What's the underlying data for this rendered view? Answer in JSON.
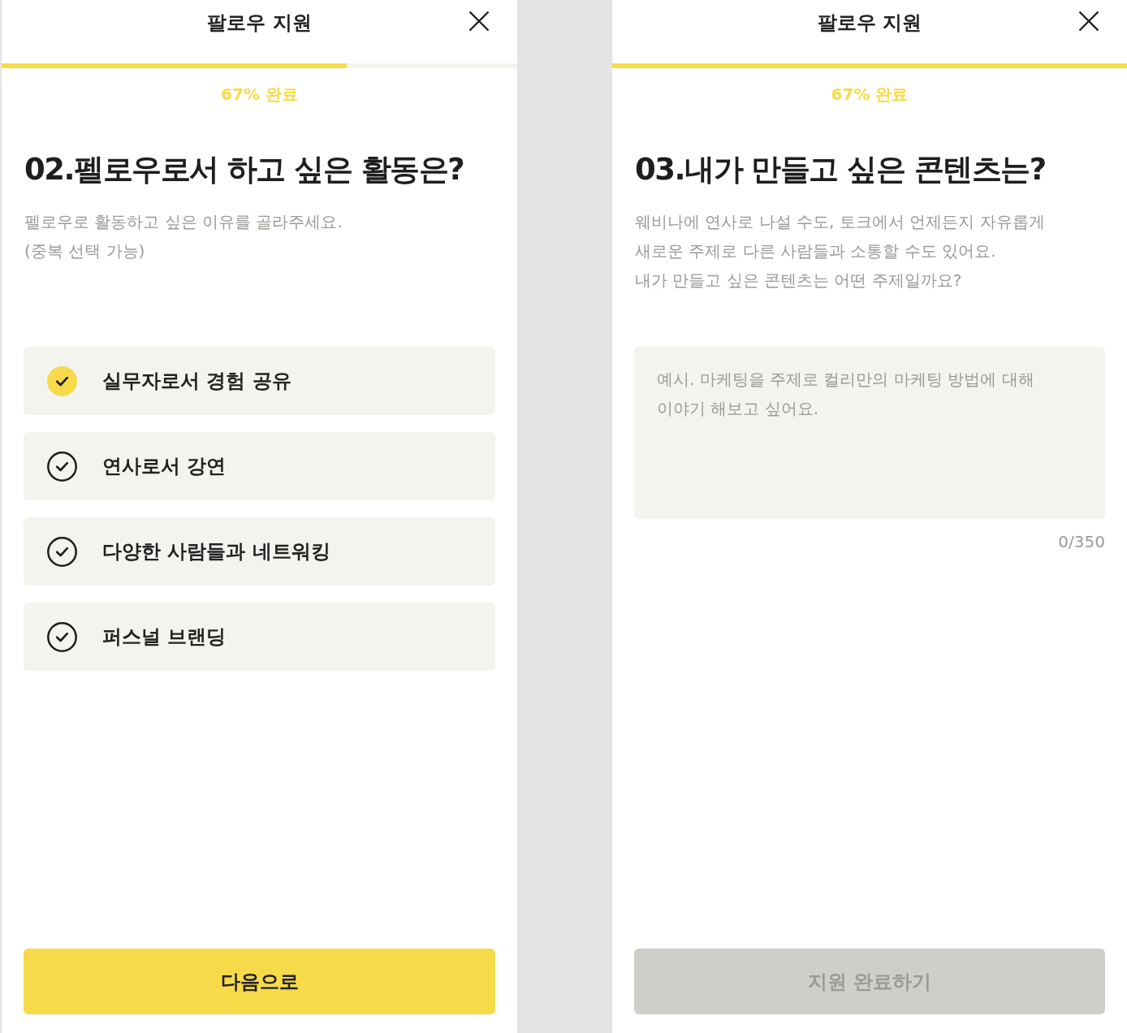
{
  "screens": [
    {
      "kind": "choice",
      "header": {
        "title": "팔로우 지원"
      },
      "progress": {
        "level": 0.67,
        "label": "67% 완료"
      },
      "question": {
        "title": "02.펠로우로서 하고 싶은 활동은?",
        "description": "펠로우로 활동하고 싶은 이유를 골라주세요.\n(중복 선택 가능)"
      },
      "options": [
        {
          "label": "실무자로서 경험 공유",
          "selected": true
        },
        {
          "label": "연사로서 강연",
          "selected": false
        },
        {
          "label": "다양한 사람들과 네트워킹",
          "selected": false
        },
        {
          "label": "퍼스널 브랜딩",
          "selected": false
        }
      ],
      "button": {
        "label": "다음으로",
        "disabled": false
      }
    },
    {
      "kind": "text",
      "header": {
        "title": "팔로우 지원"
      },
      "progress": {
        "level": 1,
        "label": "67% 완료"
      },
      "question": {
        "title": "03.내가 만들고 싶은 콘텐츠는?",
        "description": "웨비나에 연사로 나설 수도, 토크에서 언제든지 자유롭게\n새로운 주제로 다른 사람들과 소통할 수도 있어요.\n내가 만들고 싶은 콘텐츠는 어떤 주제일까요?"
      },
      "answer": {
        "placeholder": "예시. 마케팅을 주제로 컬리만의 마케팅 방법에 대해\n이야기 해보고 싶어요.",
        "counter": "0/350"
      },
      "button": {
        "label": "지원 완료하기",
        "disabled": true
      }
    }
  ]
}
